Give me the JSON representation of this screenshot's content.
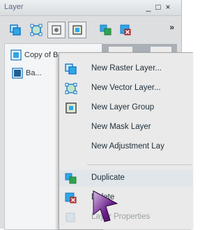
{
  "window": {
    "title": "Layer",
    "minimize_glyph": "_",
    "maximize_glyph": "□",
    "close_glyph": "×",
    "more_glyph": "»"
  },
  "toolbar": {
    "icons": [
      "new-raster-layer-icon",
      "new-vector-layer-icon",
      "new-mask-icon",
      "new-group-icon",
      "duplicate-layer-icon",
      "delete-layer-icon"
    ]
  },
  "layers": [
    {
      "name": "Copy of B...",
      "icon": "raster-layer-icon"
    },
    {
      "name": "Ba...",
      "icon": "background-layer-icon"
    }
  ],
  "context_menu": {
    "items": [
      {
        "label": "New Raster Layer...",
        "icon": "new-raster-layer-icon",
        "enabled": true
      },
      {
        "label": "New Vector Layer...",
        "icon": "new-vector-layer-icon",
        "enabled": true
      },
      {
        "label": "New Layer Group",
        "icon": "new-group-icon",
        "enabled": true
      },
      {
        "label": "New Mask Layer",
        "icon": "",
        "enabled": true
      },
      {
        "label": "New Adjustment Lay",
        "icon": "",
        "enabled": true
      },
      {
        "label": "Duplicate",
        "icon": "duplicate-layer-icon",
        "enabled": true,
        "highlighted": true
      },
      {
        "label": "Delete",
        "icon": "delete-layer-icon",
        "enabled": true
      },
      {
        "label": "Layer Properties",
        "icon": "properties-icon",
        "enabled": false
      }
    ]
  },
  "colors": {
    "accent_blue": "#1778c7",
    "accent_green": "#2ea44f",
    "delete_red": "#d23a3a",
    "cursor_purple": "#6a1f8a"
  }
}
